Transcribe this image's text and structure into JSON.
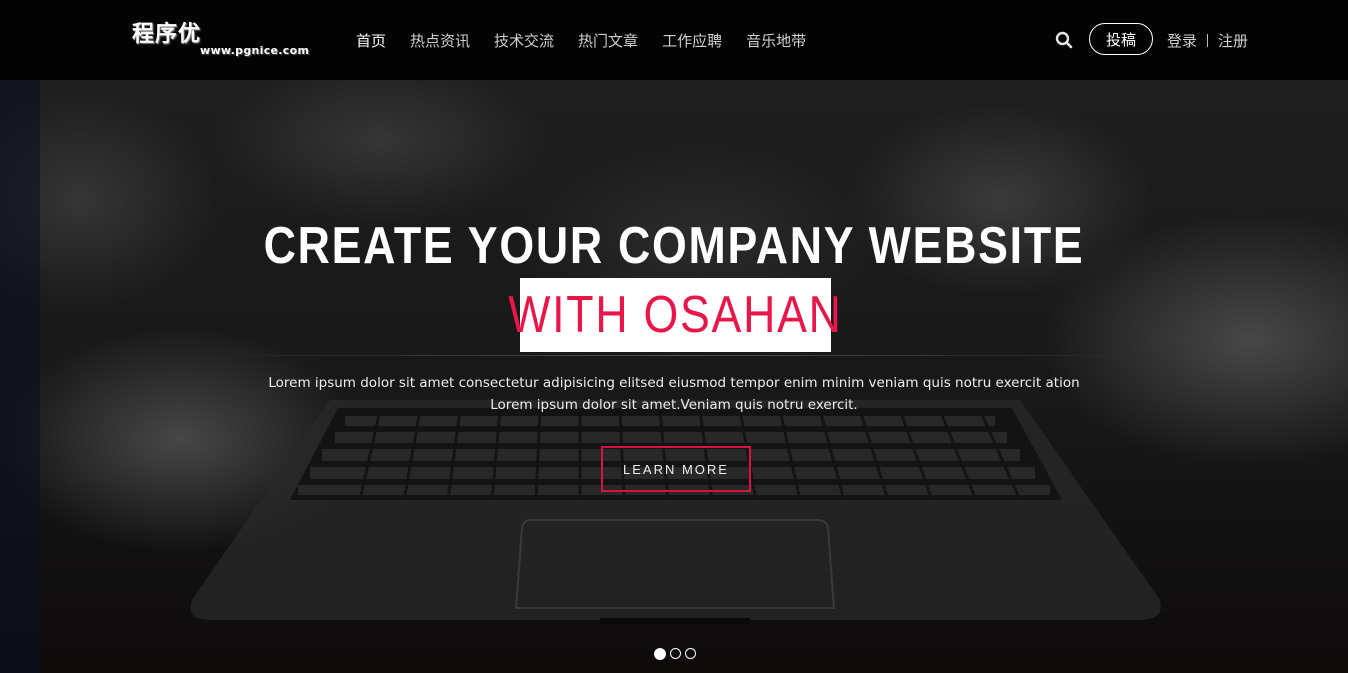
{
  "header": {
    "logo_text": "程序优",
    "logo_url": "www.pgnice.com",
    "nav": [
      {
        "label": "首页",
        "active": true
      },
      {
        "label": "热点资讯",
        "active": false
      },
      {
        "label": "技术交流",
        "active": false
      },
      {
        "label": "热门文章",
        "active": false
      },
      {
        "label": "工作应聘",
        "active": false
      },
      {
        "label": "音乐地带",
        "active": false
      }
    ],
    "search_icon": "search-icon",
    "submit_label": "投稿",
    "login_label": "登录",
    "register_label": "注册"
  },
  "hero": {
    "title": "CREATE YOUR COMPANY WEBSITE",
    "highlight": "WITH OSAHAN",
    "description_line1": "Lorem ipsum dolor sit amet consectetur adipisicing elitsed eiusmod tempor enim minim veniam quis notru exercit ation",
    "description_line2": "Lorem ipsum dolor sit amet.Veniam quis notru exercit.",
    "button_label": "LEARN MORE",
    "slides_total": 3,
    "slide_active": 1
  },
  "colors": {
    "accent": "#e8174a",
    "header_bg": "#030303"
  }
}
